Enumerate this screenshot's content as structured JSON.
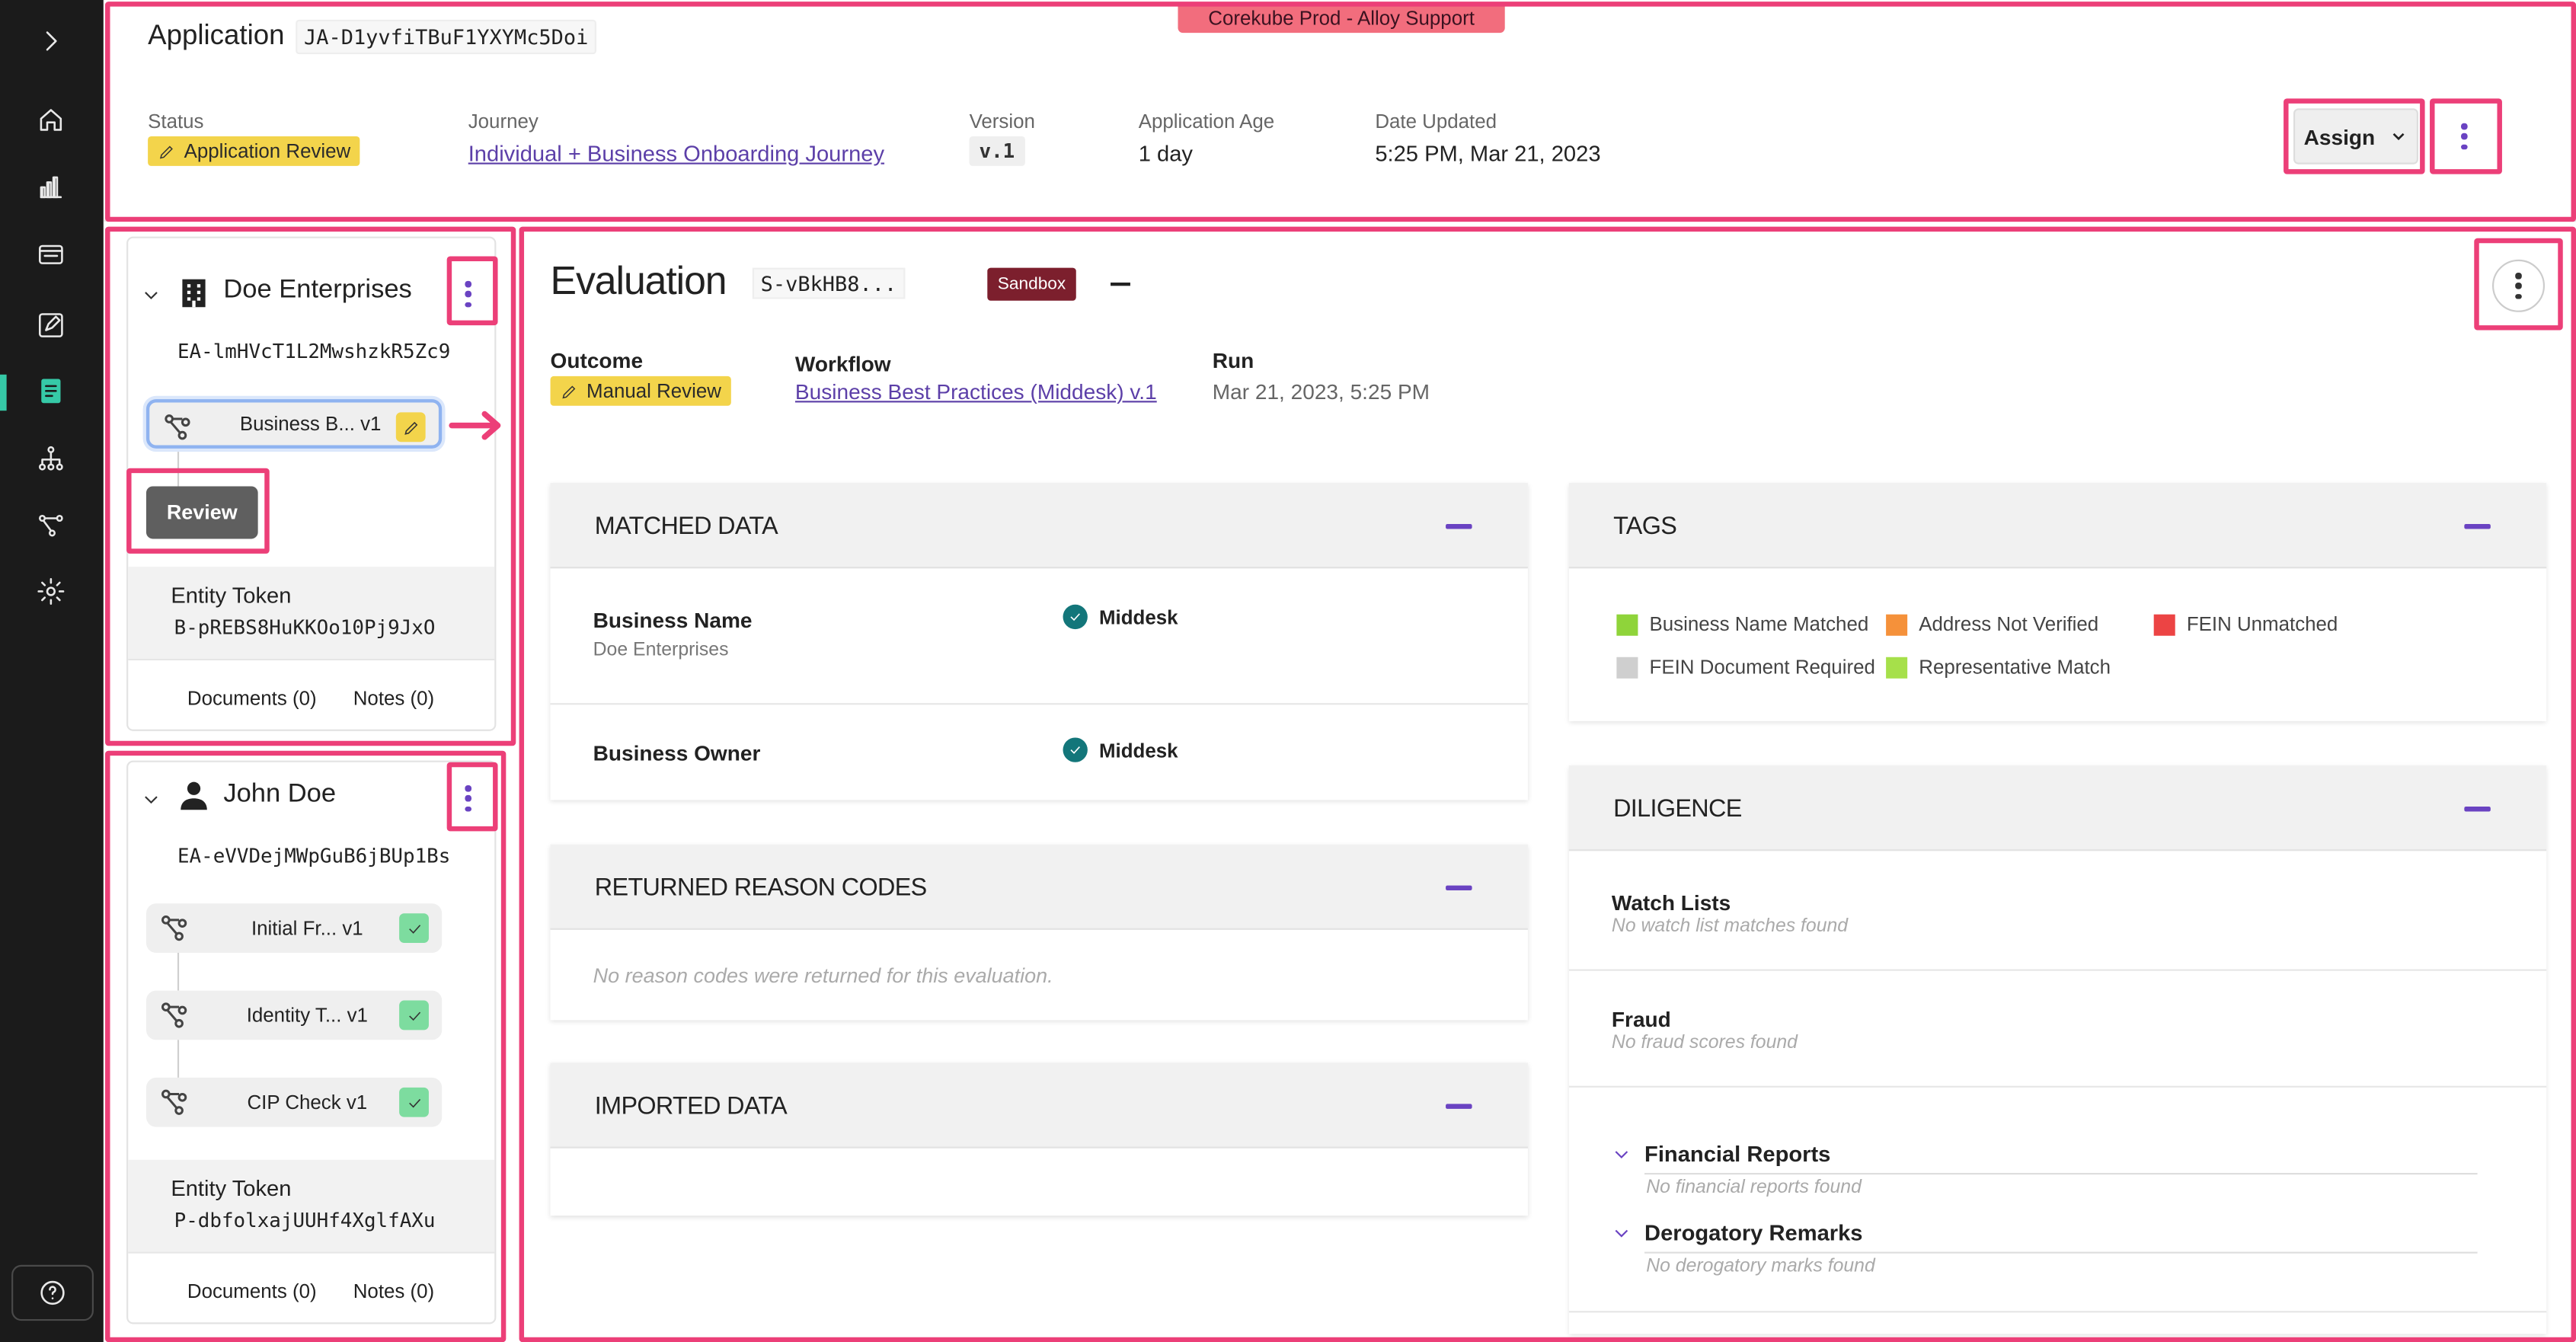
{
  "environment_banner": "Corekube Prod - Alloy Support",
  "application": {
    "title": "Application",
    "id": "JA-D1yvfiTBuF1YXYMc5Doi",
    "status_label": "Status",
    "status": "Application Review",
    "journey_label": "Journey",
    "journey": "Individual + Business Onboarding Journey",
    "version_label": "Version",
    "version": "v.1",
    "age_label": "Application Age",
    "age": "1 day",
    "updated_label": "Date Updated",
    "updated": "5:25 PM, Mar 21, 2023",
    "assign_label": "Assign"
  },
  "sidebar": {
    "icons": [
      "chevron-right-icon",
      "home-icon",
      "bar-chart-icon",
      "inbox-icon",
      "edit-icon",
      "book-icon",
      "hierarchy-icon",
      "workflow-icon",
      "settings-icon",
      "help-icon"
    ]
  },
  "entities": [
    {
      "name": "Doe Enterprises",
      "type_icon": "building-icon",
      "id": "EA-lmHVcT1L2MwshzkR5Zc9",
      "workflows": [
        {
          "label": "Business B... v1",
          "state": "edit"
        }
      ],
      "review_label": "Review",
      "token_label": "Entity Token",
      "token": "B-pREBS8HuKKOo10Pj9JxO",
      "documents": "Documents (0)",
      "notes": "Notes (0)"
    },
    {
      "name": "John Doe",
      "type_icon": "person-icon",
      "id": "EA-eVVDejMWpGuB6jBUp1Bs",
      "workflows": [
        {
          "label": "Initial Fr... v1",
          "state": "done"
        },
        {
          "label": "Identity T... v1",
          "state": "done"
        },
        {
          "label": "CIP Check v1",
          "state": "done"
        }
      ],
      "token_label": "Entity Token",
      "token": "P-dbfolxajUUHf4XglfAXu",
      "documents": "Documents (0)",
      "notes": "Notes (0)"
    }
  ],
  "evaluation": {
    "title": "Evaluation",
    "id": "S-vBkHB8...",
    "sandbox": "Sandbox",
    "outcome_label": "Outcome",
    "outcome": "Manual Review",
    "workflow_label": "Workflow",
    "workflow": "Business Best Practices (Middesk) v.1",
    "run_label": "Run",
    "run": "Mar 21, 2023, 5:25 PM"
  },
  "matched_data": {
    "title": "MATCHED DATA",
    "rows": [
      {
        "title": "Business Name",
        "value": "Doe Enterprises",
        "source": "Middesk"
      },
      {
        "title": "Business Owner",
        "value": "",
        "source": "Middesk"
      }
    ]
  },
  "reason_codes": {
    "title": "RETURNED REASON CODES",
    "empty": "No reason codes were returned for this evaluation."
  },
  "imported_data": {
    "title": "IMPORTED DATA"
  },
  "tags": {
    "title": "TAGS",
    "items": [
      {
        "label": "Business Name Matched",
        "color": "#8fd43a"
      },
      {
        "label": "Address Not Verified",
        "color": "#f5913a"
      },
      {
        "label": "FEIN Unmatched",
        "color": "#ec4444"
      },
      {
        "label": "FEIN Document Required",
        "color": "#cfcfcf"
      },
      {
        "label": "Representative Match",
        "color": "#a6e04a"
      }
    ]
  },
  "diligence": {
    "title": "DILIGENCE",
    "watch_title": "Watch Lists",
    "watch_empty": "No watch list matches found",
    "fraud_title": "Fraud",
    "fraud_empty": "No fraud scores found",
    "financial_title": "Financial Reports",
    "financial_empty": "No financial reports found",
    "derog_title": "Derogatory Remarks",
    "derog_empty": "No derogatory marks found"
  },
  "colors": {
    "accent_purple": "#6a43c2",
    "highlight_pink": "#ec3f78",
    "badge_yellow": "#f3d44b",
    "sandbox": "#7c1f2d",
    "check_teal": "#13767a",
    "banner": "#f26d7d"
  }
}
